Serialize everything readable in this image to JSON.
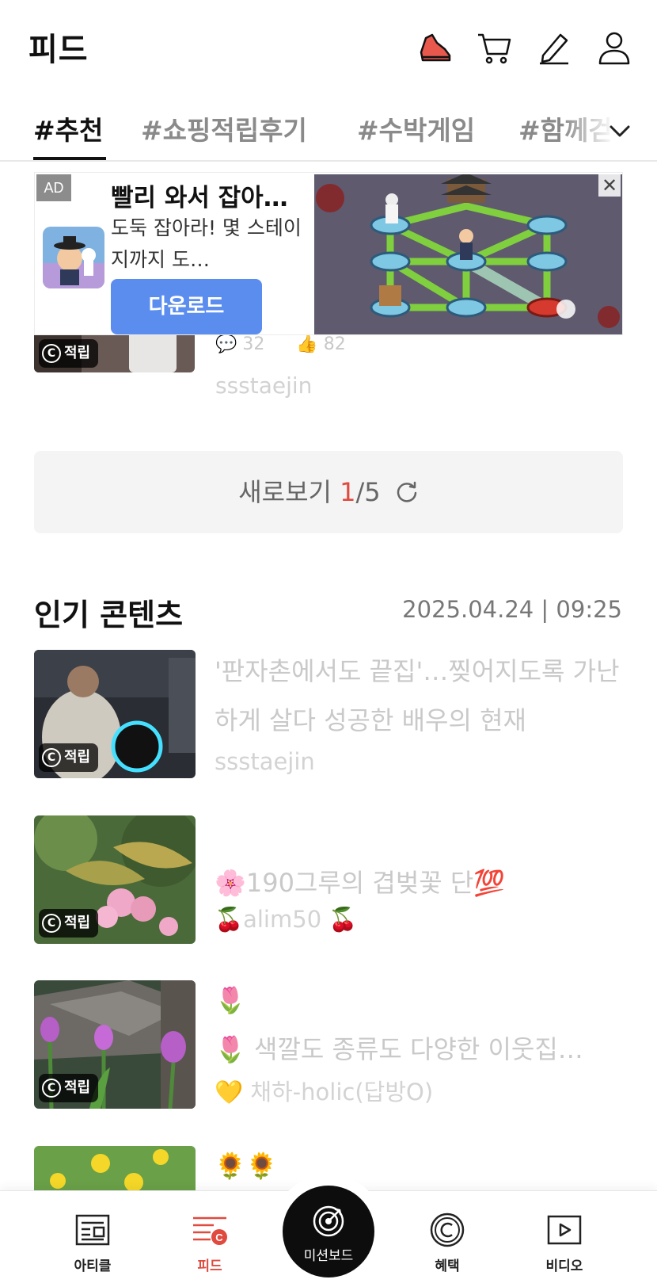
{
  "header": {
    "title": "피드",
    "icons": [
      "sneaker-icon",
      "cart-icon",
      "pencil-icon",
      "user-icon"
    ]
  },
  "tabs": [
    {
      "label": "#추천",
      "active": true
    },
    {
      "label": "#쇼핑적립후기",
      "active": false
    },
    {
      "label": "#수박게임",
      "active": false
    },
    {
      "label": "#함께걷기",
      "active": false
    }
  ],
  "ad": {
    "badge": "AD",
    "title": "빨리 와서 잡아…",
    "description": "도둑 잡아라! 몇 스테이지까지 도…",
    "button": "다운로드",
    "close": "✕"
  },
  "cut_item": {
    "badge": "적립",
    "comments": "32",
    "likes": "82",
    "author": "ssstaejin"
  },
  "refresh": {
    "label": "새로보기",
    "current": "1",
    "total": "/5"
  },
  "popular": {
    "title": "인기 콘텐츠",
    "timestamp": "2025.04.24 | 09:25",
    "items": [
      {
        "badge": "적립",
        "title": "'판자촌에서도 끝집'…찢어지도록 가난하게 살다 성공한 배우의 현재",
        "author": "ssstaejin"
      },
      {
        "badge": "적립",
        "title": "🌸190그루의 겹벚꽃 단💯",
        "author": "🍒alim50 🍒"
      },
      {
        "badge": "적립",
        "title_line1": "🌷",
        "title_line2": "🌷  색깔도 종류도 다양한 이웃집…",
        "author": "💛 채하-holic(답방O)"
      },
      {
        "title": "🌻🌻"
      }
    ]
  },
  "bottom_nav": {
    "items": [
      {
        "label": "아티클",
        "active": false
      },
      {
        "label": "피드",
        "active": true
      },
      {
        "label": "미션보드",
        "active": false
      },
      {
        "label": "혜택",
        "active": false
      },
      {
        "label": "비디오",
        "active": false
      }
    ]
  },
  "colors": {
    "accent": "#e04a3f",
    "ad_button": "#5b8def",
    "muted_text": "#c9c9c9"
  }
}
